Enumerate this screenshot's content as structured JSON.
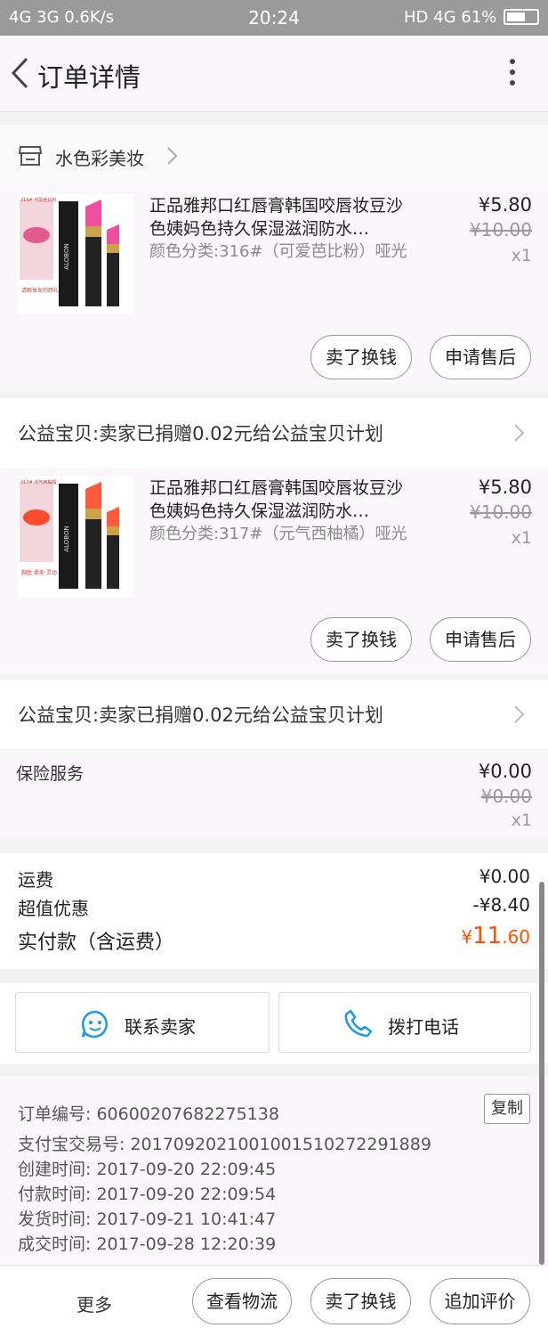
{
  "status_bar": {
    "left": "4G 3G 0.6K/s",
    "time": "20:24",
    "right": "HD 4G 61%",
    "battery_level": 0.61
  },
  "header": {
    "title": "订单详情"
  },
  "shop": {
    "name": "水色彩美妆"
  },
  "products": [
    {
      "title": "正品雅邦口红唇膏韩国咬唇妆豆沙色姨妈色持久保湿滋润防水…",
      "sku": "颜色分类:316#（可爱芭比粉）哑光",
      "price": "¥5.80",
      "orig_price": "¥10.00",
      "qty": "x1",
      "thumb_color": "#ef4fa0",
      "thumb_tag": "316# 可爱芭比粉"
    },
    {
      "title": "正品雅邦口红唇膏韩国咬唇妆豆沙色姨妈色持久保湿滋润防水…",
      "sku": "颜色分类:317#（元气西柚橘）哑光",
      "price": "¥5.80",
      "orig_price": "¥10.00",
      "qty": "x1",
      "thumb_color": "#ff5a3c",
      "thumb_tag": "317# 元气西柚橘"
    }
  ],
  "actions": {
    "sell_exchange": "卖了换钱",
    "after_sale": "申请售后"
  },
  "charity_text": "公益宝贝:卖家已捐赠0.02元给公益宝贝计划",
  "insurance": {
    "label": "保险服务",
    "price": "¥0.00",
    "orig_price": "¥0.00",
    "qty": "x1"
  },
  "fees": {
    "shipping_label": "运费",
    "shipping_value": "¥0.00",
    "discount_label": "超值优惠",
    "discount_value": "-¥8.40",
    "total_label": "实付款（含运费）",
    "total_currency": "¥",
    "total_int": "11",
    "total_cents": ".60"
  },
  "contact": {
    "seller": "联系卖家",
    "phone": "拨打电话"
  },
  "order_info": {
    "order_no": "订单编号: 60600207682275138",
    "copy": "复制",
    "alipay_no": "支付宝交易号: 2017092021001001510272291889",
    "created": "创建时间: 2017-09-20 22:09:45",
    "paid": "付款时间: 2017-09-20 22:09:54",
    "shipped": "发货时间: 2017-09-21 10:41:47",
    "completed": "成交时间: 2017-09-28 12:20:39"
  },
  "bottom": {
    "more": "更多",
    "logistics": "查看物流",
    "sell_exchange": "卖了换钱",
    "add_review": "追加评价"
  },
  "colors": {
    "accent": "#ff5000",
    "icon_blue": "#1e9ae0"
  }
}
